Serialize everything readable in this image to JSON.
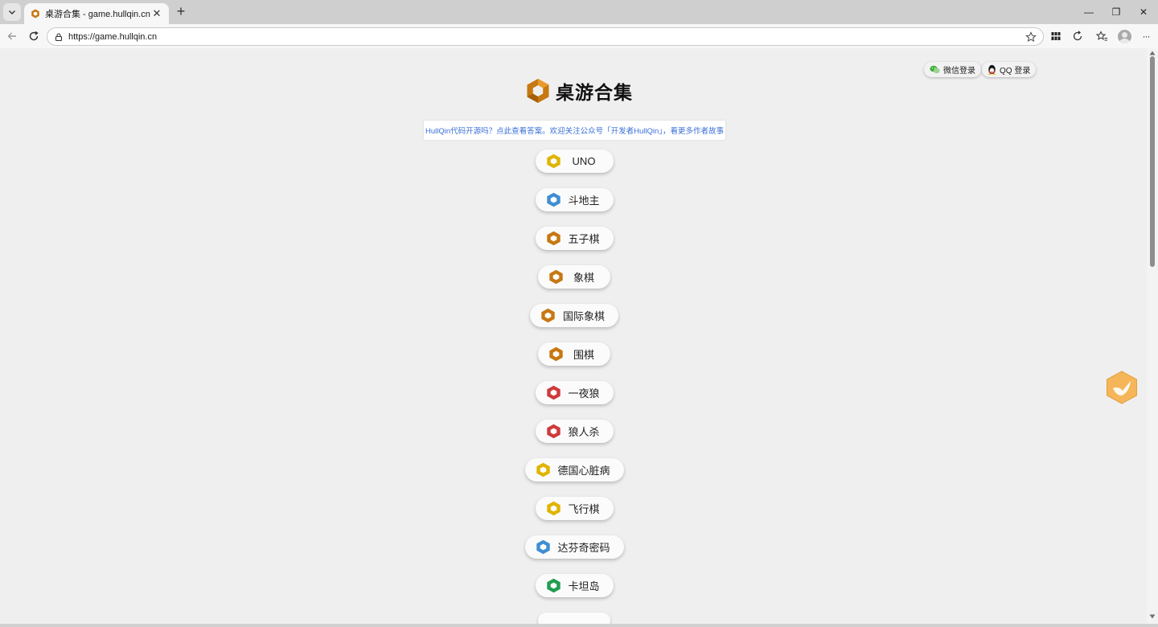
{
  "browser": {
    "tab": {
      "title": "桌游合集 - game.hullqin.cn",
      "close_glyph": "✕"
    },
    "new_tab_glyph": "+",
    "window_controls": {
      "minimize": "—",
      "restore": "❐",
      "close": "✕"
    },
    "address_bar": {
      "url": "https://game.hullqin.cn"
    },
    "more_glyph": "···"
  },
  "page": {
    "login": {
      "wechat_label": "微信登录",
      "qq_label": "QQ 登录"
    },
    "title": "桌游合集",
    "notice": "HullQin代码开源吗？点此查看答案。欢迎关注公众号「开发者HullQin」，看更多作者故事",
    "games": [
      {
        "label": "UNO",
        "icon": "hex-yellow-icon",
        "color": "#e0b400"
      },
      {
        "label": "斗地主",
        "icon": "hex-blue-icon",
        "color": "#3f8ed3"
      },
      {
        "label": "五子棋",
        "icon": "hex-orange-icon",
        "color": "#c77811"
      },
      {
        "label": "象棋",
        "icon": "hex-orange-icon",
        "color": "#c77811"
      },
      {
        "label": "国际象棋",
        "icon": "hex-orange-icon",
        "color": "#c77811"
      },
      {
        "label": "围棋",
        "icon": "hex-orange-icon",
        "color": "#c77811"
      },
      {
        "label": "一夜狼",
        "icon": "hex-red-icon",
        "color": "#cf3a3a"
      },
      {
        "label": "狼人杀",
        "icon": "hex-red-icon",
        "color": "#cf3a3a"
      },
      {
        "label": "德国心脏病",
        "icon": "hex-yellow-icon",
        "color": "#e0b400"
      },
      {
        "label": "飞行棋",
        "icon": "hex-yellow-icon",
        "color": "#e0b400"
      },
      {
        "label": "达芬奇密码",
        "icon": "hex-blue-icon",
        "color": "#3f8ed3"
      },
      {
        "label": "卡坦岛",
        "icon": "hex-green-icon",
        "color": "#1e9e4f"
      }
    ],
    "colors": {
      "brand_orange": "#c77811",
      "link_blue": "#3a6fd8",
      "page_bg": "#efefef"
    }
  }
}
